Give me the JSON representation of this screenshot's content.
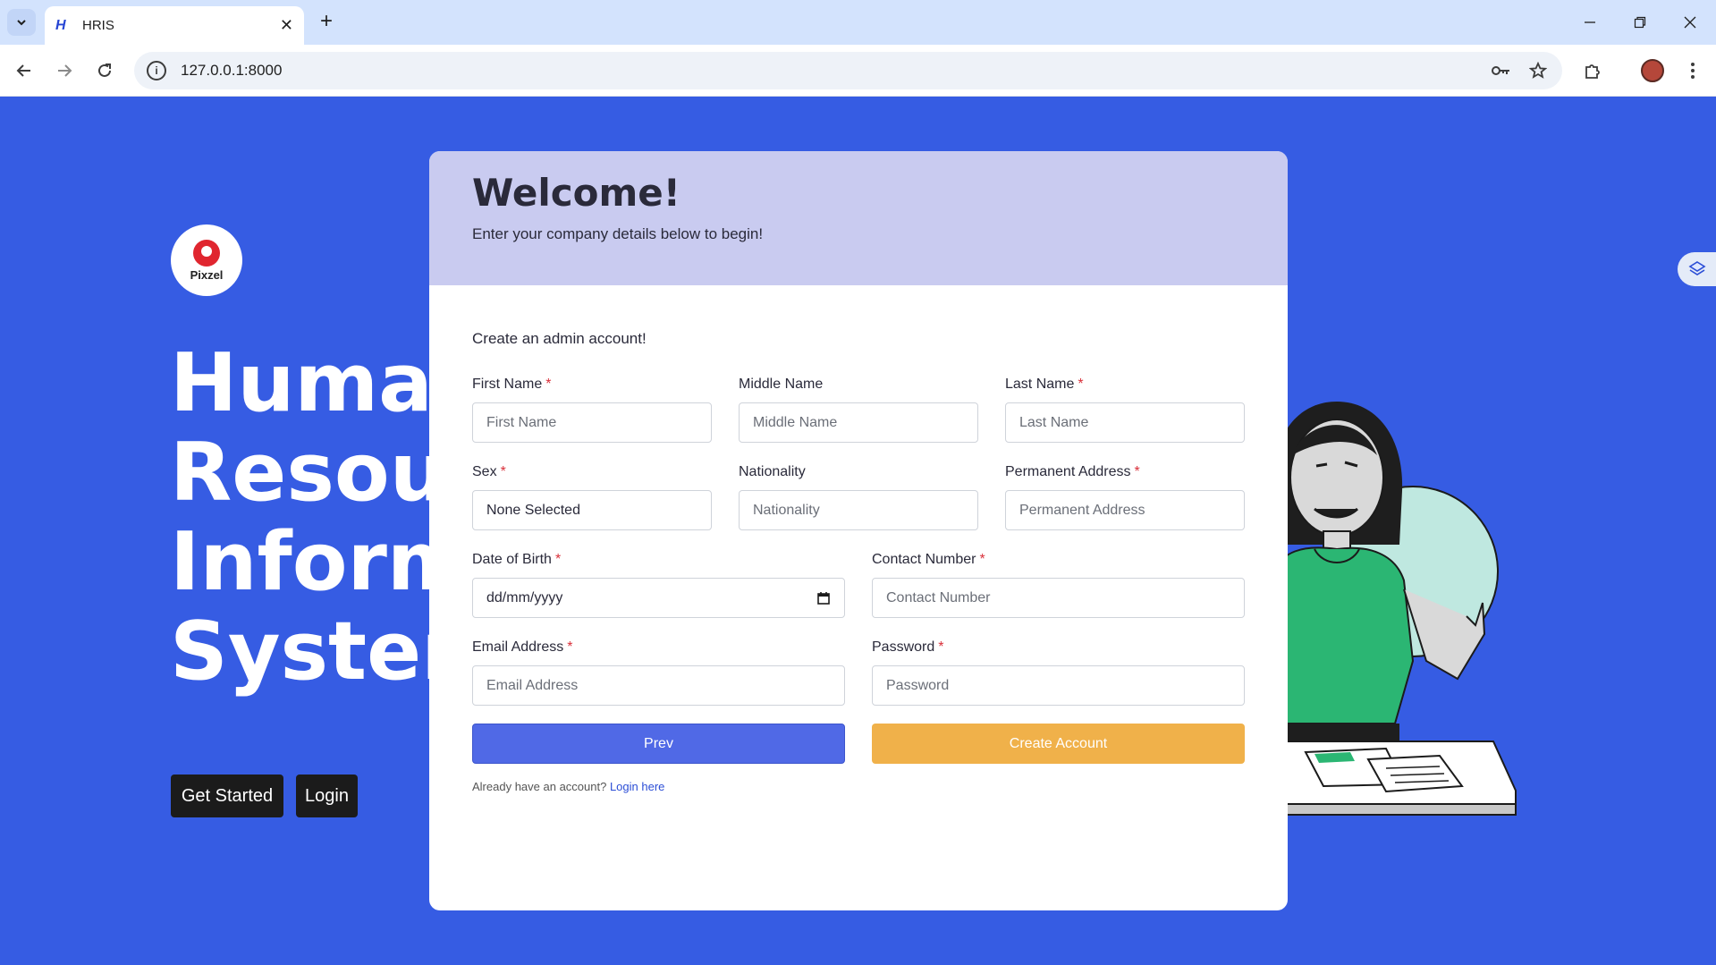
{
  "browser": {
    "tab_title": "HRIS",
    "favicon_letter": "H",
    "url": "127.0.0.1:8000",
    "new_tab_label": "+"
  },
  "hero": {
    "logo_text": "Pixzel",
    "title_lines": [
      "Human",
      "Resources",
      "Information",
      "System"
    ],
    "get_started_label": "Get Started",
    "login_label": "Login"
  },
  "card": {
    "heading": "Welcome!",
    "subheading": "Enter your company details below to begin!",
    "section_title": "Create an admin account!",
    "fields": {
      "first_name": {
        "label": "First Name",
        "placeholder": "First Name"
      },
      "middle_name": {
        "label": "Middle Name",
        "placeholder": "Middle Name"
      },
      "last_name": {
        "label": "Last Name",
        "placeholder": "Last Name"
      },
      "sex": {
        "label": "Sex",
        "value": "None Selected"
      },
      "nationality": {
        "label": "Nationality",
        "placeholder": "Nationality"
      },
      "permanent_address": {
        "label": "Permanent Address",
        "placeholder": "Permanent Address"
      },
      "date_of_birth": {
        "label": "Date of Birth",
        "value": "dd/mm/yyyy"
      },
      "contact_number": {
        "label": "Contact Number",
        "placeholder": "Contact Number"
      },
      "email": {
        "label": "Email Address",
        "placeholder": "Email Address"
      },
      "password": {
        "label": "Password",
        "placeholder": "Password"
      }
    },
    "required_marker": "*",
    "prev_label": "Prev",
    "create_label": "Create Account",
    "login_prompt": "Already have an account?",
    "login_link": "Login here"
  },
  "colors": {
    "page_bg": "#365ce3",
    "header_bg": "#c9cbf0",
    "prev_button": "#5069e6",
    "create_button": "#f0b14a",
    "required": "#d9303a"
  }
}
